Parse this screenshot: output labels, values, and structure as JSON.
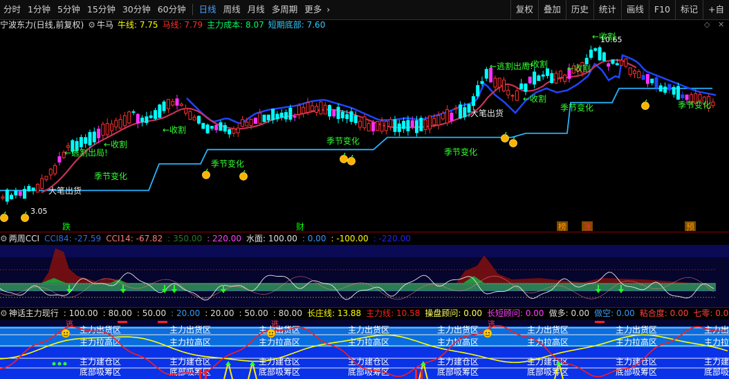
{
  "toolbar": {
    "periods": [
      "分时",
      "1分钟",
      "5分钟",
      "15分钟",
      "30分钟",
      "60分钟",
      "日线",
      "周线",
      "月线",
      "多周期",
      "更多"
    ],
    "active_period": "日线",
    "more_chevron": "›",
    "right_buttons": [
      "复权",
      "叠加",
      "历史",
      "统计",
      "画线",
      "F10",
      "标记",
      "+自"
    ]
  },
  "main_info": {
    "stock_title": "宁波东力(日线,前复权)",
    "indicator_name": "牛马",
    "items": [
      {
        "label": "牛线:",
        "value": "7.75",
        "color": "#ffff00"
      },
      {
        "label": "马线:",
        "value": "7.79",
        "color": "#ff3030"
      },
      {
        "label": "主力成本:",
        "value": "8.07",
        "color": "#00ff66"
      },
      {
        "label": "短期底部:",
        "value": "7.60",
        "color": "#33ccff"
      }
    ],
    "window_icons": [
      "diamond-icon",
      "close-icon"
    ]
  },
  "main_chart": {
    "price_labels": [
      {
        "text": "10.65",
        "color": "#ffffff"
      },
      {
        "text": "3.05",
        "color": "#ffffff"
      }
    ],
    "annotations": {
      "shou_ge": "←收割",
      "tao_ge_chu_ju": "←逃割出局!",
      "ji_jie_bian_hua": "季节变化",
      "da_bi_chu_huo": "大笔出货"
    },
    "bottom_markers": [
      {
        "text": "跌",
        "color": "#00ff00"
      },
      {
        "text": "财",
        "color": "#00ff00"
      },
      {
        "text": "榜",
        "color": "#ff9900"
      },
      {
        "text": "涨",
        "color": "#ff3030"
      },
      {
        "text": "预",
        "color": "#ff9900"
      }
    ],
    "colors": {
      "up": "#ff3030",
      "down": "#00ffff",
      "magenta": "#ff30ff",
      "blue_line": "#1e46ff",
      "cyan_line": "#28b4ff",
      "maroon_line": "#c8325a",
      "label_green": "#32ff32"
    }
  },
  "cci_panel": {
    "name": "两周CCI",
    "items": [
      {
        "label": "CCI84:",
        "value": "-27.59",
        "color": "#2d6ee6"
      },
      {
        "label": "CCI14:",
        "value": "-67.82",
        "color": "#ff7a7a"
      },
      {
        "label": ":",
        "value": "350.00",
        "color": "#2a7a2a"
      },
      {
        "label": ":",
        "value": "220.00",
        "color": "#ff40ff"
      },
      {
        "label": "水面:",
        "value": "100.00",
        "color": "#e0e0e0"
      },
      {
        "label": ":",
        "value": "0.00",
        "color": "#3399ff"
      },
      {
        "label": ":",
        "value": "-100.00",
        "color": "#ffff00"
      },
      {
        "label": ":",
        "value": "-220.00",
        "color": "#2222ff"
      }
    ]
  },
  "myth_panel": {
    "name": "神话主力现行",
    "items": [
      {
        "label": ":",
        "value": "100.00",
        "color": "#dddddd"
      },
      {
        "label": ":",
        "value": "80.00",
        "color": "#dddddd"
      },
      {
        "label": ":",
        "value": "50.00",
        "color": "#dddddd"
      },
      {
        "label": ":",
        "value": "20.00",
        "color": "#3399ff"
      },
      {
        "label": ":",
        "value": "20.00",
        "color": "#dddddd"
      },
      {
        "label": ":",
        "value": "50.00",
        "color": "#dddddd"
      },
      {
        "label": ":",
        "value": "80.00",
        "color": "#dddddd"
      },
      {
        "label": "长庄线:",
        "value": "13.88",
        "color": "#ffff00"
      },
      {
        "label": "主力线:",
        "value": "10.58",
        "color": "#ff2020"
      },
      {
        "label": "操盘顾问:",
        "value": "0.00",
        "color": "#ffff66"
      },
      {
        "label": "长短顾问:",
        "value": "0.00",
        "color": "#ff40ff"
      },
      {
        "label": "做多:",
        "value": "0.00",
        "color": "#dddddd"
      },
      {
        "label": "做空:",
        "value": "0.00",
        "color": "#3399ff"
      },
      {
        "label": "粘合度:",
        "value": "0.00",
        "color": "#ff4040"
      },
      {
        "label": "七零:",
        "value": "0.00",
        "color": "#ff4040"
      },
      {
        "label": "一二:",
        "value": "",
        "color": "#ffff00"
      }
    ],
    "zone_labels": {
      "out": "主力出货区",
      "pull": "主力拉高区",
      "build": "主力建仓区",
      "bottom": "底部吸筹区",
      "out_partial": "主力出",
      "pull_partial": "主力拉",
      "build_partial": "主力建",
      "bottom_partial": "底部吸"
    },
    "top_marker": "逃"
  }
}
